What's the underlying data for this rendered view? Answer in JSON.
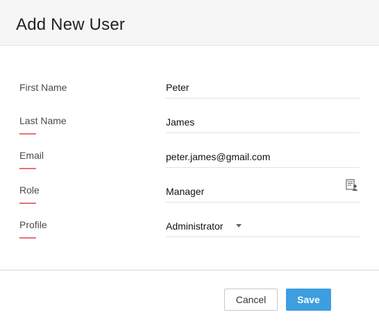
{
  "dialog": {
    "title": "Add New User"
  },
  "form": {
    "fields": [
      {
        "label": "First Name",
        "value": "Peter"
      },
      {
        "label": "Last Name",
        "value": "James"
      },
      {
        "label": "Email",
        "value": "peter.james@gmail.com"
      },
      {
        "label": "Role",
        "value": "Manager"
      },
      {
        "label": "Profile",
        "value": "Administrator"
      }
    ]
  },
  "icons": {
    "role_lookup": "user-lookup-icon",
    "profile_dropdown": "caret-down-icon"
  },
  "colors": {
    "accent": "#e57373",
    "primary_button": "#3d9ee0"
  },
  "footer": {
    "cancel_label": "Cancel",
    "save_label": "Save"
  }
}
